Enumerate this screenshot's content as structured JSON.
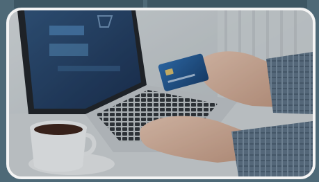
{
  "photo": {
    "subject": "laptop-with-credit-card-payment",
    "colors": {
      "background": "#4e6977",
      "frame_border": "#f4f4f4",
      "laptop_screen": "#1f3f64",
      "card": "#1d4f8a",
      "shirt": "#5d7184"
    }
  }
}
